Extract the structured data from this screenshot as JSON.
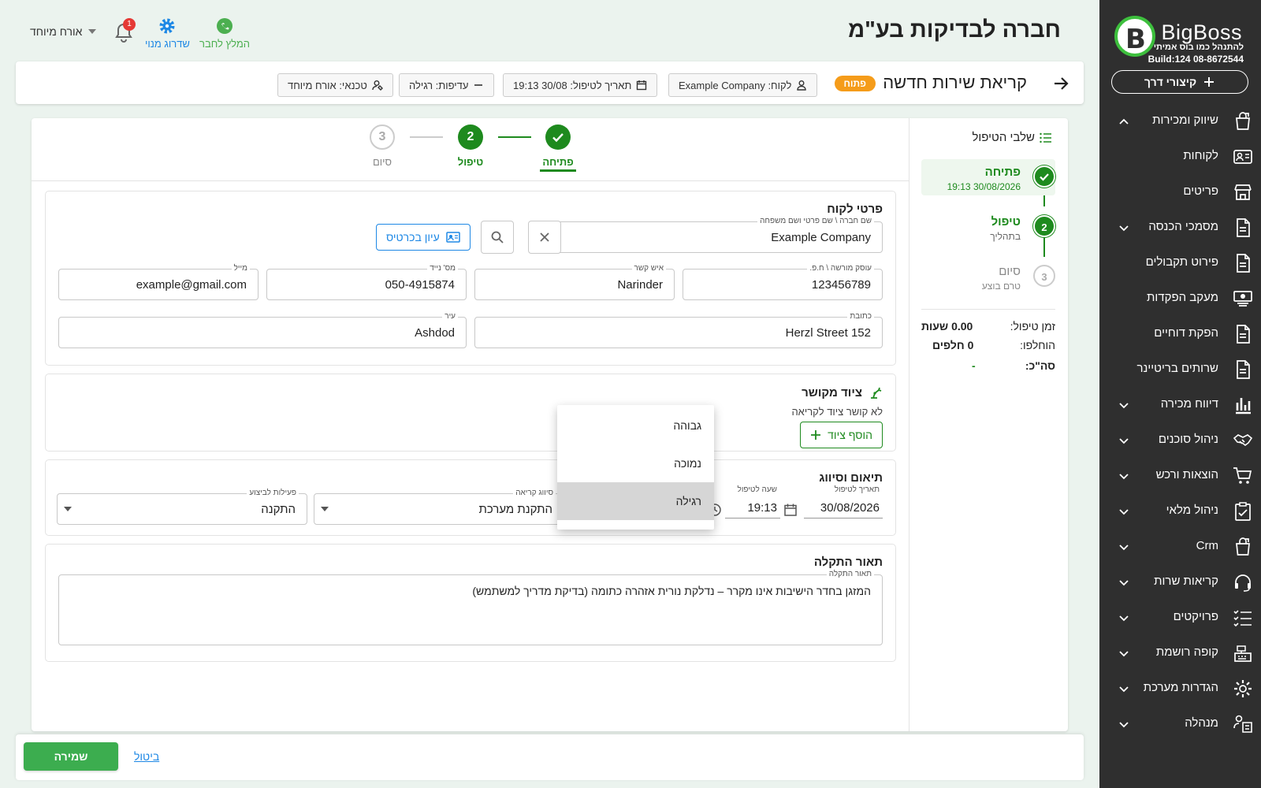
{
  "brand": {
    "name": "BigBoss",
    "tagline": "להתנהל כמו בוס אמיתי",
    "phone": "08-8672544",
    "build": "Build:124",
    "accent": "#1e8a1e"
  },
  "sidebar": {
    "shortcut_label": "קיצורי דרך",
    "items": [
      {
        "label": "שיווק ומכירות",
        "icon": "bag-icon",
        "chevron": "up"
      },
      {
        "label": "לקוחות",
        "icon": "id-card-icon",
        "chevron": ""
      },
      {
        "label": "פריטים",
        "icon": "store-icon",
        "chevron": ""
      },
      {
        "label": "מסמכי הכנסה",
        "icon": "document-icon",
        "chevron": "down"
      },
      {
        "label": "פירוט תקבולים",
        "icon": "document-icon",
        "chevron": ""
      },
      {
        "label": "מעקב הפקדות",
        "icon": "cash-icon",
        "chevron": ""
      },
      {
        "label": "הפקת דוחיים",
        "icon": "document-icon",
        "chevron": ""
      },
      {
        "label": "שרותים בריטיינר",
        "icon": "document-icon",
        "chevron": ""
      },
      {
        "label": "דיווח מכירה",
        "icon": "chart-icon",
        "chevron": "down"
      },
      {
        "label": "ניהול סוכנים",
        "icon": "handshake-icon",
        "chevron": "down"
      },
      {
        "label": "הוצאות ורכש",
        "icon": "cart-icon",
        "chevron": "down"
      },
      {
        "label": "ניהול מלאי",
        "icon": "clipboard-icon",
        "chevron": "down"
      },
      {
        "label": "Crm",
        "icon": "bag-icon",
        "chevron": "down"
      },
      {
        "label": "קריאות שרות",
        "icon": "headset-icon",
        "chevron": "down"
      },
      {
        "label": "פרויקטים",
        "icon": "checklist-icon",
        "chevron": "down"
      },
      {
        "label": "קופה רושמת",
        "icon": "register-icon",
        "chevron": "down"
      },
      {
        "label": "הגדרות מערכת",
        "icon": "gear-icon",
        "chevron": "down"
      },
      {
        "label": "מנהלה",
        "icon": "admin-icon",
        "chevron": "down"
      }
    ]
  },
  "top": {
    "company": "חברה לבדיקות בע\"מ",
    "recommend_label": "המלץ לחבר",
    "upgrade_label": "שדרוג מנוי",
    "notification_count": "1",
    "user_name": "אורח מיוחד"
  },
  "header": {
    "title": "קריאת שירות חדשה",
    "status": "פתוח",
    "chips": {
      "customer": "לקוח: Example Company",
      "date": "תאריך לטיפול: 30/08 19:13",
      "priority": "עדיפות: רגילה",
      "technician": "טכנאי: אורח מיוחד"
    }
  },
  "stepper": {
    "steps": [
      {
        "num": "1",
        "label": "פתיחה",
        "state": "done"
      },
      {
        "num": "2",
        "label": "טיפול",
        "state": "active"
      },
      {
        "num": "3",
        "label": "סיום",
        "state": "pending"
      }
    ]
  },
  "side_steps": {
    "title": "שלבי הטיפול",
    "items": [
      {
        "num": "1",
        "title": "פתיחה",
        "sub": "30/08/2026 19:13"
      },
      {
        "num": "2",
        "title": "טיפול",
        "sub": "בתהליך"
      },
      {
        "num": "3",
        "title": "סיום",
        "sub": "טרם בוצע"
      }
    ],
    "summary": {
      "time_label": "זמן טיפול:",
      "time_value": "0.00 שעות",
      "parts_label": "הוחלפו:",
      "parts_value": "0 חלפים",
      "total_label": "סה\"כ:",
      "total_value": "-"
    }
  },
  "customer": {
    "title": "פרטי לקוח",
    "name_label": "שם חברה \\ שם פרטי ושם משפחה",
    "name_value": "Example Company",
    "card_button": "עיון בכרטיס",
    "fields": [
      {
        "label": "עוסק מורשה \\ ח.פ.",
        "value": "123456789"
      },
      {
        "label": "איש קשר",
        "value": "Narinder"
      },
      {
        "label": "מס' נייד",
        "value": "050-4915874"
      },
      {
        "label": "מייל",
        "value": "example@gmail.com"
      },
      {
        "label": "כתובת",
        "value": "Herzl Street 152"
      },
      {
        "label": "עיר",
        "value": "Ashdod"
      }
    ]
  },
  "equipment": {
    "title": "ציוד מקושר",
    "note": "לא קושר ציוד לקריאה",
    "add_button": "הוסף ציוד"
  },
  "scheduling": {
    "title": "תיאום וסיווג",
    "date_label": "תאריך לטיפול",
    "date_value": "30/08/2026",
    "time_label": "שעה לטיפול",
    "time_value": "19:13",
    "class_label": "סיווג קריאה",
    "class_value": "התקנת מערכת",
    "action_label": "פעילות לביצוע",
    "action_value": "התקנה"
  },
  "priority_dropdown": {
    "options": [
      "גבוהה",
      "נמוכה",
      "רגילה"
    ],
    "selected": "רגילה"
  },
  "problem": {
    "title": "תאור התקלה",
    "label": "תאור התקלה",
    "value": "המזגן בחדר הישיבות אינו מקרר – נדלקת נורית אזהרה כתומה (בדיקת מדריך למשתמש)"
  },
  "footer": {
    "save_label": "שמירה",
    "cancel_label": "ביטול"
  }
}
